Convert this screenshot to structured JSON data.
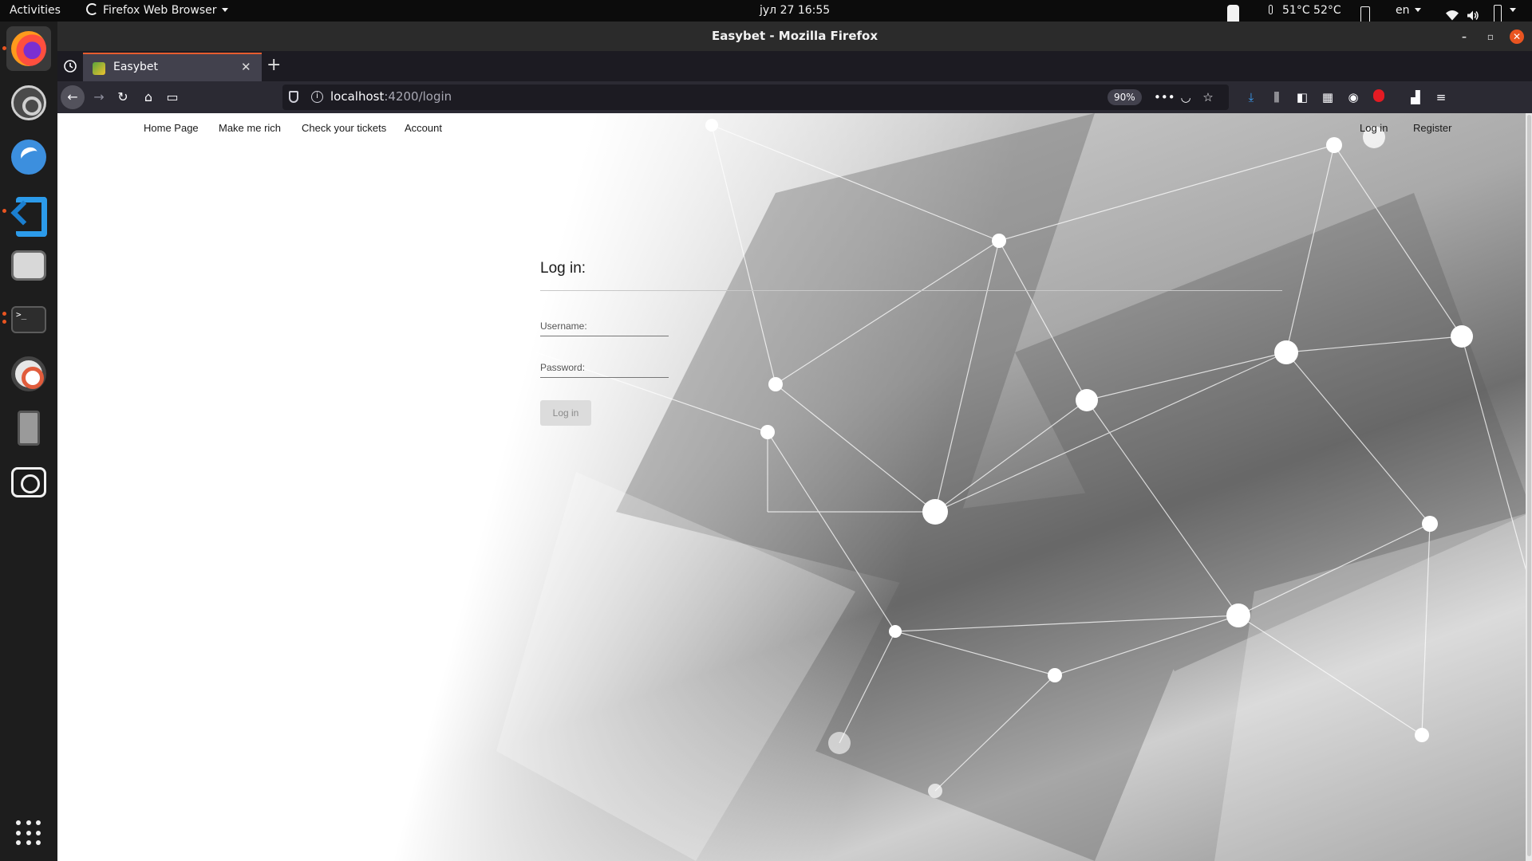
{
  "topbar": {
    "activities": "Activities",
    "app_menu": "Firefox Web Browser",
    "clock": "јул 27  16:55",
    "temps": "51°C 52°C",
    "language": "en"
  },
  "dock": {
    "items": [
      "firefox",
      "settings",
      "thunderbird",
      "vscode",
      "files",
      "terminal",
      "help",
      "phone",
      "camera"
    ]
  },
  "window": {
    "title": "Easybet - Mozilla Firefox"
  },
  "tabs": [
    {
      "title": "Easybet",
      "active": true
    }
  ],
  "urlbar": {
    "host": "localhost",
    "rest": ":4200/login",
    "zoom": "90%"
  },
  "site_nav": {
    "left": [
      "Home Page",
      "Make me rich",
      "Check your tickets",
      "Account"
    ],
    "right": [
      "Log in",
      "Register"
    ]
  },
  "login": {
    "title": "Log in:",
    "username_label": "Username:",
    "password_label": "Password:",
    "submit_label": "Log in"
  },
  "colors": {
    "accent": "#e95420",
    "tab_highlight": "#e65c2e",
    "download_icon": "#3ba0f7"
  }
}
